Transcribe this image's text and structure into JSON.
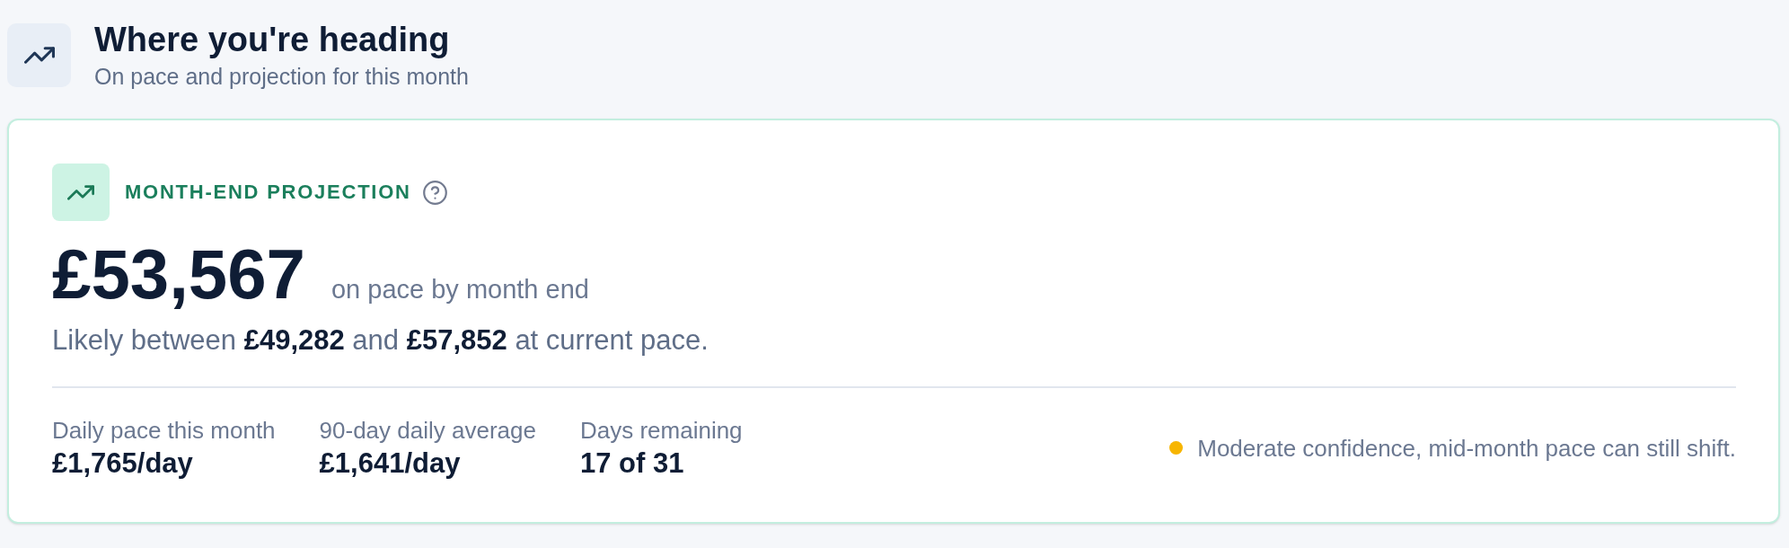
{
  "header": {
    "title": "Where you're heading",
    "subtitle": "On pace and projection for this month"
  },
  "projection": {
    "label": "MONTH-END PROJECTION",
    "amount": "£53,567",
    "amount_caption": "on pace by month end",
    "range_text": "Likely between **£49,282** and **£57,852** at current pace."
  },
  "stats": [
    {
      "label": "Daily pace this month",
      "value": "£1,765/day"
    },
    {
      "label": "90-day daily average",
      "value": "£1,641/day"
    },
    {
      "label": "Days remaining",
      "value": "17 of 31"
    }
  ],
  "confidence": {
    "text": "Moderate confidence, mid-month pace can still shift."
  }
}
